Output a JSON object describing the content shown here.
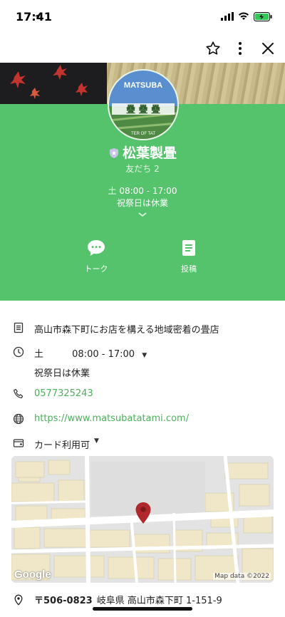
{
  "status": {
    "time": "17:41"
  },
  "profile": {
    "name": "松葉製畳",
    "friends": "友だち 2",
    "hours_line1": "土 08:00 - 17:00",
    "hours_line2": "祝祭日は休業",
    "logo_text": "MATSUBA",
    "logo_caption": "TER OF TAT"
  },
  "actions": [
    {
      "label": "トーク"
    },
    {
      "label": "投稿"
    }
  ],
  "info": {
    "description": "高山市森下町にお店を構える地域密着の畳店",
    "hours_day": "土",
    "hours_time": "08:00 - 17:00",
    "hours_note": "祝祭日は休業",
    "phone": "0577325243",
    "website": "https://www.matsubatatami.com/",
    "payment": "カード利用可",
    "postal": "〒506-0823",
    "address": "岐阜県 高山市森下町 1-151-9"
  },
  "map": {
    "google": "Google",
    "credit": "Map data ©2022"
  },
  "colors": {
    "green": "#55c36b",
    "link": "#4cb05c",
    "pin": "#b0282b"
  }
}
